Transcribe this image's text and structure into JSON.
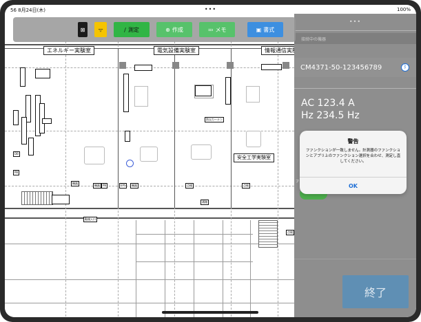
{
  "status_bar": {
    "time_date": "56  8月24日(木)",
    "center_dots": "•••",
    "battery": "100%"
  },
  "toolbar": {
    "close_label": "⊠",
    "wifi_label": "ᯤ",
    "measure_label": "測定",
    "create_label": "作成",
    "memo_label": "メモ",
    "format_label": "書式",
    "colors": {
      "measure": "#31b545",
      "create": "#57c26b",
      "memo": "#57c26b",
      "format": "#3d8fe0",
      "wifi": "#f5c400",
      "close": "#1a1a1a"
    }
  },
  "floor_plan": {
    "rooms": [
      "エネルギー実験室",
      "電気設備実験室",
      "情報通信実験室",
      "安全工学実験室"
    ],
    "tags": [
      "防災カーテン",
      "機器",
      "機器",
      "機器",
      "点検",
      "点検",
      "通路",
      "点検",
      "點検入口",
      "DB",
      "PB",
      "PB",
      "EPS",
      "機器"
    ],
    "crosshair": "target"
  },
  "panel": {
    "grip": "•••",
    "section_header": "接続中の機器",
    "device_id": "CM4371-50-123456789",
    "bluetooth_icon": "bluetooth-icon",
    "current_reading": "AC 123.4 A",
    "frequency_reading": "Hz 234.5 Hz",
    "peek_label_1": "PE",
    "peek_label_2": "ファ",
    "end_label": "終了"
  },
  "alert": {
    "title": "警告",
    "message": "ファンクションが一致しません。計測器のファンクションとアプリ上のファンクション選択を合わせ、測定し直してください。",
    "ok_label": "OK"
  }
}
